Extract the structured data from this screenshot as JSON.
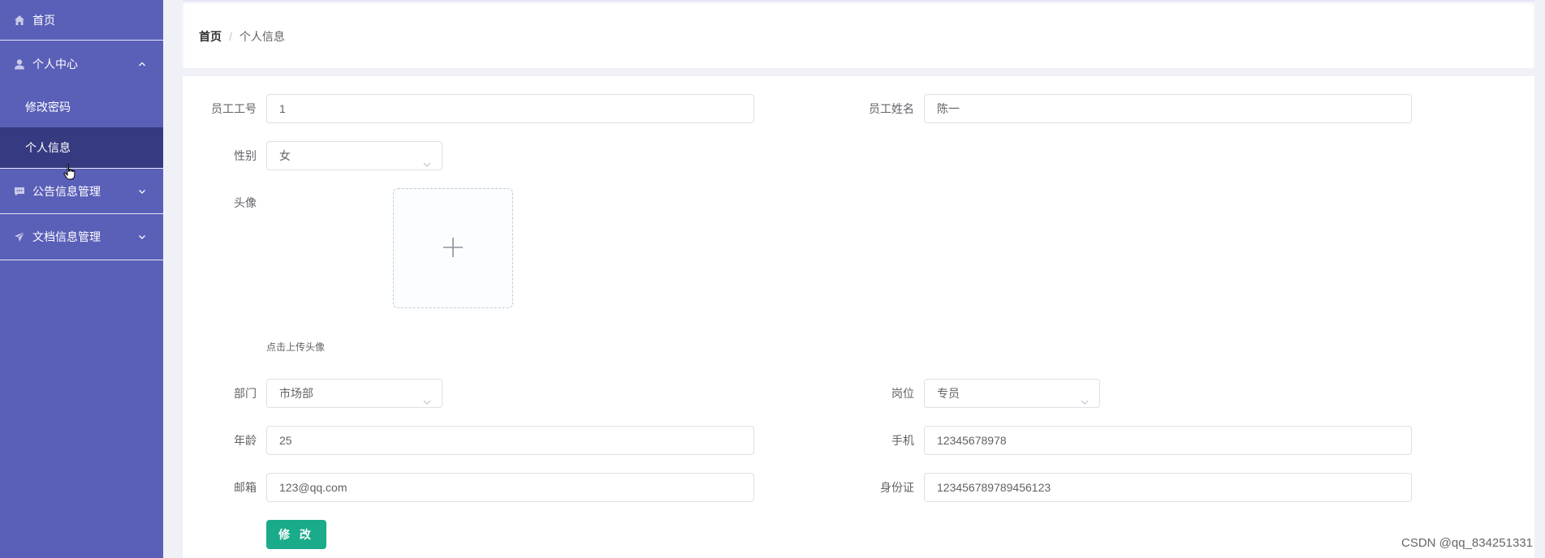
{
  "sidebar": {
    "home": {
      "label": "首页",
      "icon": "home-icon"
    },
    "personal_center": {
      "label": "个人中心",
      "icon": "user-icon",
      "children": [
        {
          "label": "修改密码"
        },
        {
          "label": "个人信息",
          "active": true
        }
      ]
    },
    "notice_mgmt": {
      "label": "公告信息管理",
      "icon": "chat-icon"
    },
    "doc_mgmt": {
      "label": "文档信息管理",
      "icon": "send-icon"
    }
  },
  "breadcrumb": {
    "home": "首页",
    "separator": "/",
    "current": "个人信息"
  },
  "form": {
    "employee_no": {
      "label": "员工工号",
      "value": "1"
    },
    "employee_name": {
      "label": "员工姓名",
      "value": "陈一"
    },
    "gender": {
      "label": "性别",
      "value": "女"
    },
    "avatar": {
      "label": "头像",
      "tip": "点击上传头像"
    },
    "department": {
      "label": "部门",
      "value": "市场部"
    },
    "position": {
      "label": "岗位",
      "value": "专员"
    },
    "age": {
      "label": "年龄",
      "value": "25"
    },
    "phone": {
      "label": "手机",
      "value": "12345678978"
    },
    "email": {
      "label": "邮箱",
      "value": "123@qq.com"
    },
    "id_card": {
      "label": "身份证",
      "value": "123456789789456123"
    },
    "submit_label": "修 改"
  },
  "watermark": "CSDN @qq_834251331",
  "colors": {
    "sidebar_bg": "#5a5fb8",
    "active_bg": "#363a80",
    "primary_button": "#1aab8a"
  }
}
